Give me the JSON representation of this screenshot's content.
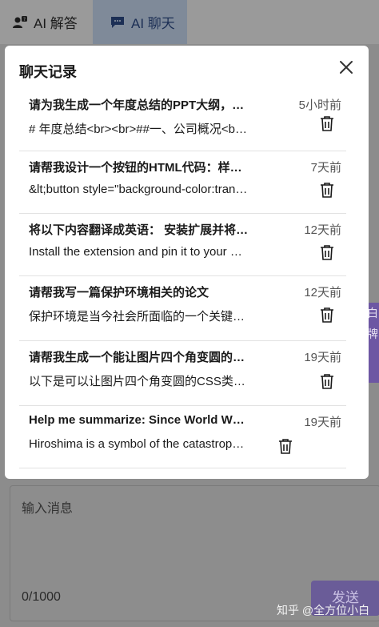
{
  "header": {
    "tabs": [
      {
        "label": "AI 解答",
        "icon": "user-question-icon"
      },
      {
        "label": "AI 聊天",
        "icon": "chat-icon"
      }
    ]
  },
  "side_tab": {
    "text": "白牌"
  },
  "modal": {
    "title": "聊天记录",
    "items": [
      {
        "title": "请为我生成一个年度总结的PPT大纲，…",
        "snippet": "# 年度总结<br><br>##一、公司概况<b…",
        "time": "5小时前"
      },
      {
        "title": "请帮我设计一个按钮的HTML代码：样…",
        "snippet": "&lt;button style=\"background-color:tran…",
        "time": "7天前"
      },
      {
        "title": "将以下内容翻译成英语：  安装扩展并将…",
        "snippet": "Install the extension and pin it to your …",
        "time": "12天前"
      },
      {
        "title": "请帮我写一篇保护环境相关的论文",
        "snippet": "保护环境是当今社会所面临的一个关键…",
        "time": "12天前"
      },
      {
        "title": "请帮我生成一个能让图片四个角变圆的…",
        "snippet": "以下是可以让图片四个角变圆的CSS类…",
        "time": "19天前"
      },
      {
        "title": "Help me summarize: Since World W…",
        "snippet": "Hiroshima is a symbol of the catastrop…",
        "time": "19天前"
      }
    ]
  },
  "composer": {
    "placeholder": "输入消息",
    "counter": "0/1000",
    "send_label": "发送"
  },
  "watermark": "知乎 @全方位小白"
}
